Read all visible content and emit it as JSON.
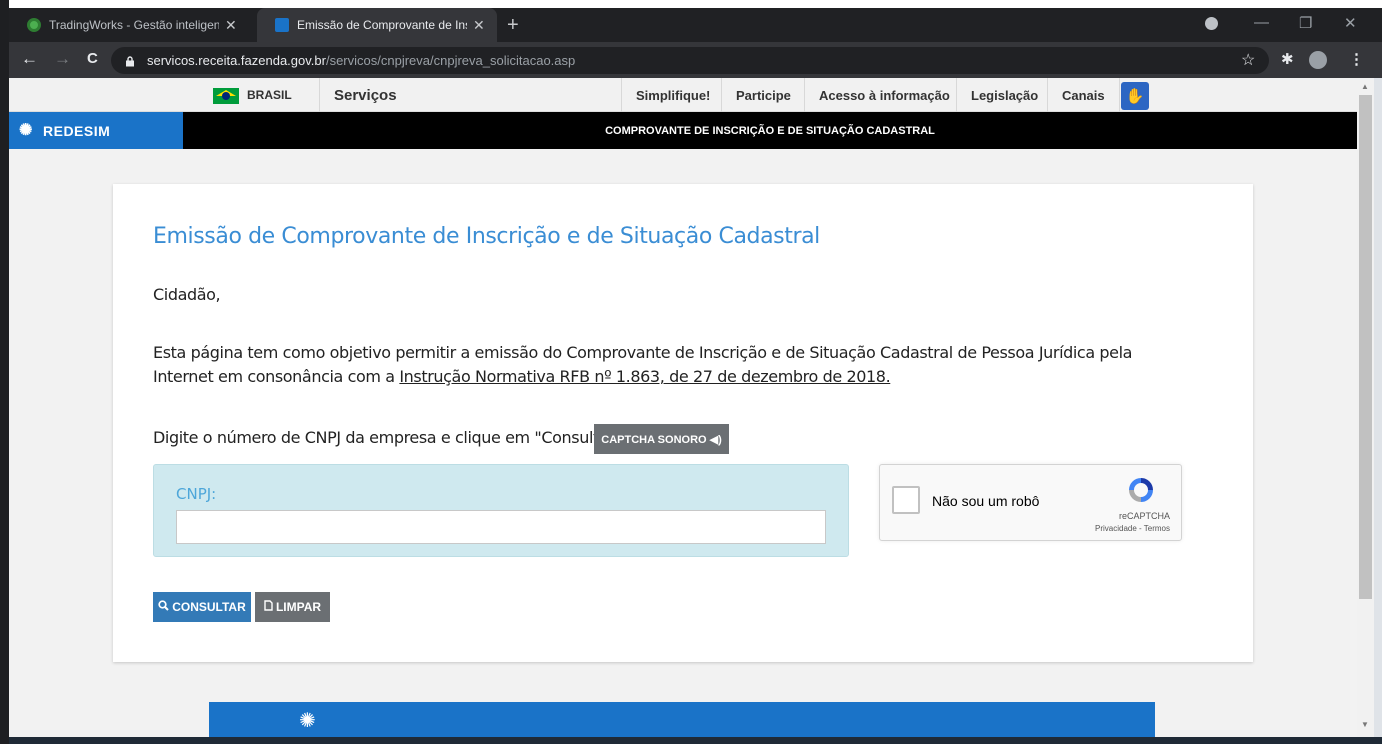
{
  "browser": {
    "tabs": [
      {
        "title": "TradingWorks - Gestão inteligent",
        "close": "✕"
      },
      {
        "title": "Emissão de Comprovante de Insc",
        "close": "✕"
      }
    ],
    "new_tab": "+",
    "url_host": "servicos.receita.fazenda.gov.br",
    "url_path": "/servicos/cnpjreva/cnpjreva_solicitacao.asp",
    "nav": {
      "back": "←",
      "forward": "→",
      "reload": "C"
    },
    "window": {
      "minimize": "—",
      "maximize": "❐",
      "close": "✕"
    },
    "icons": {
      "star": "☆",
      "extensions": "✱",
      "menu": "⋮"
    }
  },
  "govbar": {
    "brasil": "BRASIL",
    "servicos": "Serviços",
    "links": [
      "Simplifique!",
      "Participe",
      "Acesso à informação",
      "Legislação",
      "Canais"
    ]
  },
  "redesim": {
    "logo": "REDESIM",
    "title": "COMPROVANTE DE INSCRIÇÃO E DE SITUAÇÃO CADASTRAL"
  },
  "content": {
    "heading": "Emissão de Comprovante de Inscrição e de Situação Cadastral",
    "greeting": "Cidadão,",
    "paragraph": "Esta página tem como objetivo permitir a emissão do Comprovante de Inscrição e de Situação Cadastral de Pessoa Jurídica pela Internet em consonância com a",
    "link": "Instrução Normativa RFB nº 1.863, de 27 de dezembro de 2018.",
    "instruction": "Digite o número de CNPJ da empresa e clique em \"Consultar\".",
    "captcha_sonoro": "CAPTCHA SONORO ◀)",
    "cnpj_label": "CNPJ:",
    "cnpj_value": "",
    "recaptcha_label": "Não sou um robô",
    "recaptcha_brand": "reCAPTCHA",
    "recaptcha_links": "Privacidade - Termos",
    "btn_consultar": "CONSULTAR",
    "btn_limpar": "LIMPAR"
  },
  "colors": {
    "accent": "#3a8dd4",
    "redesim_blue": "#1a73c8",
    "button_primary": "#337ab7",
    "button_secondary": "#6b6f73",
    "cnpj_panel": "#cfe9ef"
  }
}
